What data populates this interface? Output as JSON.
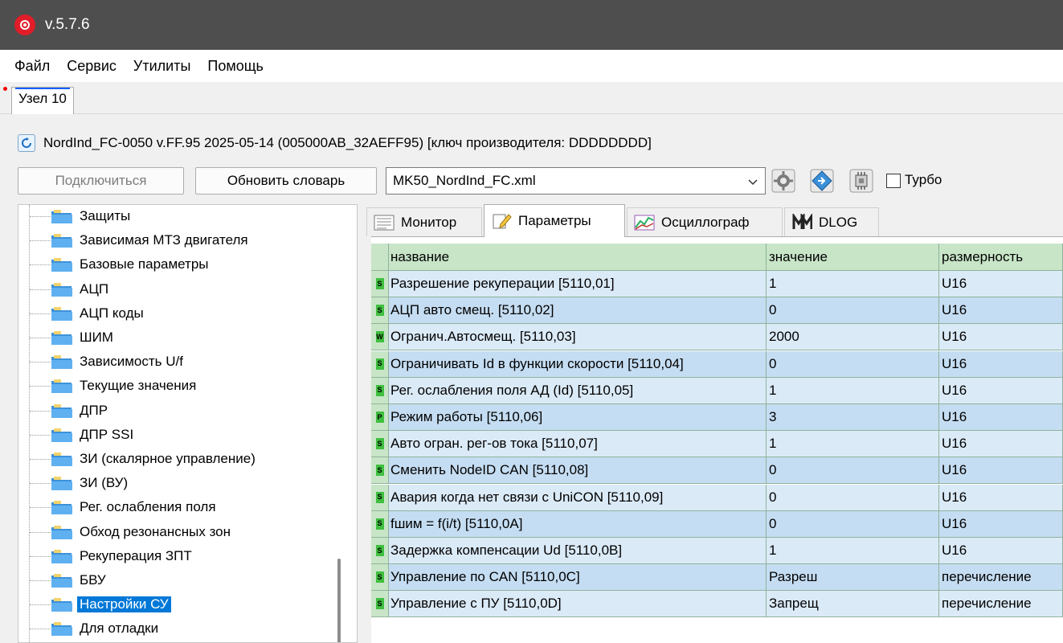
{
  "window": {
    "title": "v.5.7.6"
  },
  "menu": [
    "Файл",
    "Сервис",
    "Утилиты",
    "Помощь"
  ],
  "node_tab": "Узел 10",
  "device_info": "NordInd_FC-0050  v.FF.95  2025-05-14 (005000AB_32AEFF95) [ключ производителя: DDDDDDDD]",
  "toolbar": {
    "connect_label": "Подключиться",
    "update_dict_label": "Обновить словарь",
    "dictionary_file": "MK50_NordInd_FC.xml",
    "turbo_label": "Турбо",
    "turbo_checked": false
  },
  "tree": {
    "items": [
      "Защиты",
      "Зависимая МТЗ двигателя",
      "Базовые параметры",
      "АЦП",
      "АЦП коды",
      "ШИМ",
      "Зависимость U/f",
      "Текущие значения",
      "ДПР",
      "ДПР SSI",
      "ЗИ (скалярное управление)",
      "ЗИ (ВУ)",
      "Рег. ослабления поля",
      "Обход резонансных зон",
      "Рекуперация ЗПТ",
      "БВУ",
      "Настройки СУ",
      "Для отладки"
    ],
    "selected": "Настройки СУ"
  },
  "tabs": [
    "Монитор",
    "Параметры",
    "Осциллограф",
    "DLOG"
  ],
  "active_tab": "Параметры",
  "table": {
    "headers": [
      "название",
      "значение",
      "размерность"
    ],
    "rows": [
      {
        "badge": "S",
        "badge_color": "#3fbf3f",
        "name": "Разрешение рекуперации [5110,01]",
        "value": "1",
        "unit": "U16"
      },
      {
        "badge": "S",
        "badge_color": "#3fbf3f",
        "name": "АЦП авто смещ. [5110,02]",
        "value": "0",
        "unit": "U16"
      },
      {
        "badge": "W",
        "badge_color": "#3fbf3f",
        "name": "Огранич.Автосмещ. [5110,03]",
        "value": "2000",
        "unit": "U16"
      },
      {
        "badge": "S",
        "badge_color": "#3fbf3f",
        "name": "Ограничивать Id в функции скорости [5110,04]",
        "value": "0",
        "unit": "U16"
      },
      {
        "badge": "S",
        "badge_color": "#3fbf3f",
        "name": "Рег. ослабления поля АД (Id) [5110,05]",
        "value": "1",
        "unit": "U16"
      },
      {
        "badge": "P",
        "badge_color": "#3fbf3f",
        "name": "Режим работы [5110,06]",
        "value": "3",
        "unit": "U16"
      },
      {
        "badge": "S",
        "badge_color": "#3fbf3f",
        "name": "Авто огран. рег-ов тока [5110,07]",
        "value": "1",
        "unit": "U16"
      },
      {
        "badge": "S",
        "badge_color": "#3fbf3f",
        "name": "Сменить NodeID CAN [5110,08]",
        "value": "0",
        "unit": "U16"
      },
      {
        "badge": "S",
        "badge_color": "#3fbf3f",
        "name": "Авария когда нет связи с UniCON [5110,09]",
        "value": "0",
        "unit": "U16"
      },
      {
        "badge": "S",
        "badge_color": "#3fbf3f",
        "name": "fшим = f(i/t) [5110,0A]",
        "value": "0",
        "unit": "U16"
      },
      {
        "badge": "S",
        "badge_color": "#3fbf3f",
        "name": "Задержка компенсации Ud [5110,0B]",
        "value": "1",
        "unit": "U16"
      },
      {
        "badge": "S",
        "badge_color": "#3fbf3f",
        "name": "Управление по CAN [5110,0C]",
        "value": "Разреш",
        "unit": "перечисление"
      },
      {
        "badge": "S",
        "badge_color": "#3fbf3f",
        "name": "Управление с ПУ [5110,0D]",
        "value": "Запрещ",
        "unit": "перечисление"
      }
    ]
  },
  "icons": {
    "app": "red-gear-icon",
    "refresh": "refresh-icon",
    "settings": "gear-icon",
    "diamond": "navigation-diamond-icon",
    "chip": "chip-icon",
    "folder": "folder-icon"
  }
}
